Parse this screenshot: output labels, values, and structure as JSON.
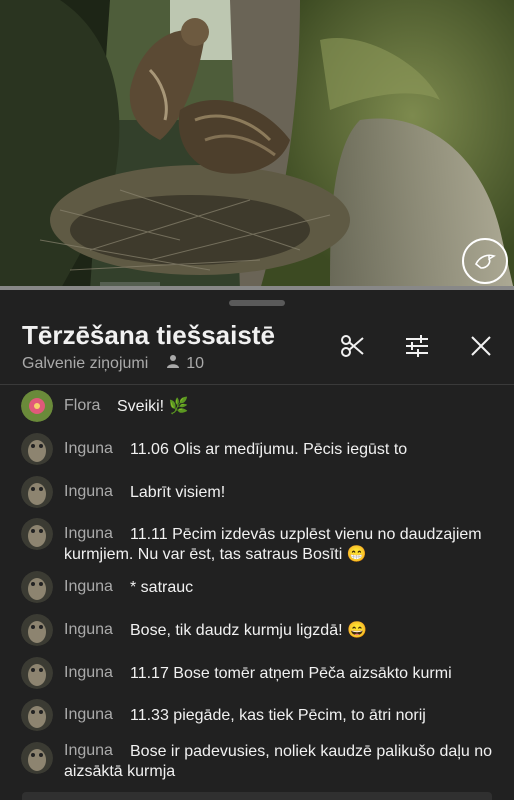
{
  "video": {
    "logo_icon": "kingfisher-logo-icon"
  },
  "header": {
    "title": "Tērzēšana tiešsaistē",
    "filter_label": "Galvenie ziņojumi",
    "viewer_count": "10",
    "icons": [
      "scissors-icon",
      "sliders-icon",
      "close-icon"
    ]
  },
  "colors": {
    "background": "#212121",
    "text": "#f1f1f1",
    "author": "#aaaaaa"
  },
  "messages": [
    {
      "author": "Flora",
      "text": "Sveiki! 🌿"
    },
    {
      "author": "Inguna",
      "text": "11.06 Olis ar medījumu. Pēcis iegūst to"
    },
    {
      "author": "Inguna",
      "text": "Labrīt visiem!"
    },
    {
      "author": "Inguna",
      "text": "11.11 Pēcim izdevās uzplēst vienu no daudzajiem",
      "text_cont": "kurmjiem. Nu var ēst, tas satraus Bosīti 😁"
    },
    {
      "author": "Inguna",
      "text": "* satrauc"
    },
    {
      "author": "Inguna",
      "text": "Bose, tik daudz kurmju ligzdā! 😄"
    },
    {
      "author": "Inguna",
      "text": "11.17 Bose tomēr atņem Pēča aizsākto kurmi"
    },
    {
      "author": "Inguna",
      "text": "11.33 piegāde, kas tiek Pēcim, to ātri norij"
    },
    {
      "author": "Inguna",
      "text": "Bose ir padevusies, noliek kaudzē palikušo daļu no",
      "text_cont": "aizsāktā kurmja"
    }
  ]
}
